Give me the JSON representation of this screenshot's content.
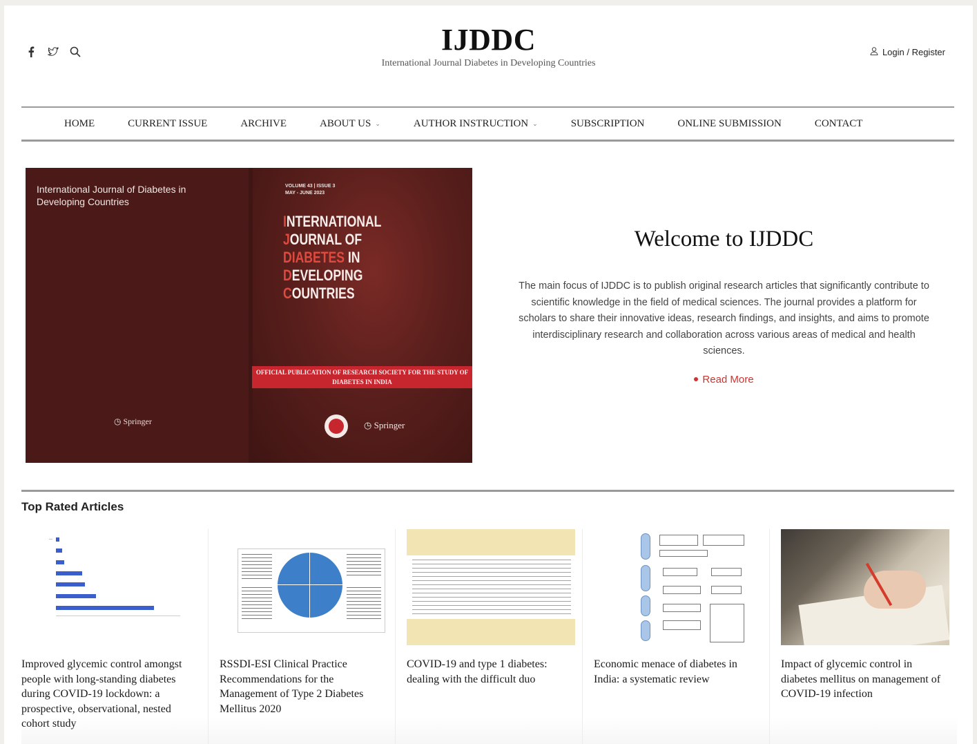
{
  "header": {
    "social": [
      "facebook-icon",
      "twitter-icon",
      "search-icon"
    ],
    "brand_title": "IJDDC",
    "brand_subtitle": "International Journal Diabetes in Developing Countries",
    "login_label": "Login / Register"
  },
  "nav": {
    "items": [
      {
        "label": "HOME"
      },
      {
        "label": "CURRENT ISSUE"
      },
      {
        "label": "ARCHIVE"
      },
      {
        "label": "ABOUT US"
      },
      {
        "label": "AUTHOR INSTRUCTION"
      },
      {
        "label": "SUBSCRIPTION"
      },
      {
        "label": "ONLINE SUBMISSION"
      },
      {
        "label": "CONTACT"
      }
    ]
  },
  "cover": {
    "back_title": "International Journal of Diabetes in Developing Countries",
    "front_title_lines": [
      "INTERNATIONAL",
      "JOURNAL OF",
      "DIABETES IN",
      "DEVELOPING",
      "COUNTRIES"
    ],
    "volume": "VOLUME 43 | ISSUE 3",
    "issue_date": "MAY - JUNE 2023",
    "banner": "OFFICIAL PUBLICATION OF RESEARCH SOCIETY FOR THE STUDY OF DIABETES IN INDIA",
    "publisher": "Springer"
  },
  "welcome": {
    "heading": "Welcome to IJDDC",
    "body": "The main focus of IJDDC is to publish original research articles that significantly contribute to scientific knowledge in the field of medical sciences. The journal provides a platform for scholars to share their innovative ideas, research findings, and insights, and aims to promote interdisciplinary research and collaboration across various areas of medical and health sciences.",
    "read_more": "Read More"
  },
  "top_rated": {
    "title": "Top Rated Articles",
    "articles": [
      {
        "title": "Improved glycemic control amongst people with long-standing diabetes during COVID-19 lockdown: a prospective, observational, nested cohort study"
      },
      {
        "title": "RSSDI-ESI Clinical Practice Recommendations for the Management of Type 2 Diabetes Mellitus 2020"
      },
      {
        "title": "COVID-19 and type 1 diabetes: dealing with the difficult duo"
      },
      {
        "title": "Economic menace of diabetes in India: a systematic review"
      },
      {
        "title": "Impact of glycemic control in diabetes mellitus on management of COVID-19 infection"
      }
    ]
  },
  "colors": {
    "accent": "#d0332f",
    "cover_bg": "#4b1a18",
    "banner_red": "#c8262f",
    "rule_gray": "#9a9a9a"
  }
}
